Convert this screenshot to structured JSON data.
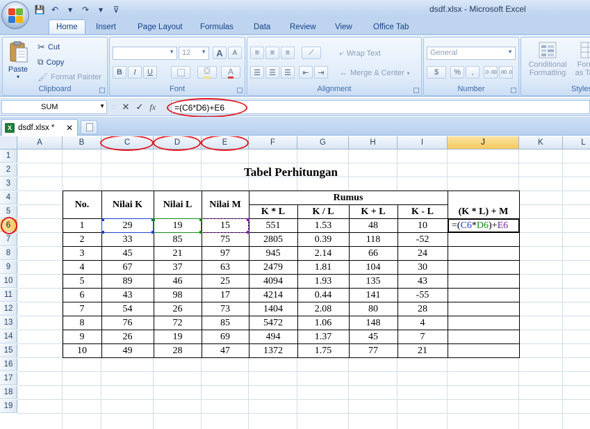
{
  "window": {
    "title": "dsdf.xlsx - Microsoft Excel",
    "quick_access": [
      {
        "icon": "save-icon",
        "glyph": "💾"
      },
      {
        "icon": "undo-icon",
        "glyph": "↶"
      },
      {
        "icon": "undo-dropdown-icon",
        "glyph": "▾"
      },
      {
        "icon": "redo-icon",
        "glyph": "↷"
      },
      {
        "icon": "redo-dropdown-icon",
        "glyph": "▾"
      },
      {
        "icon": "customize-qat-icon",
        "glyph": "⊽"
      }
    ]
  },
  "ribbon": {
    "tabs": [
      "Home",
      "Insert",
      "Page Layout",
      "Formulas",
      "Data",
      "Review",
      "View",
      "Office Tab"
    ],
    "active_tab": "Home",
    "clipboard": {
      "label": "Clipboard",
      "paste": "Paste",
      "cut": "Cut",
      "copy": "Copy",
      "format_painter": "Format Painter"
    },
    "font": {
      "label": "Font",
      "font_name": "",
      "font_size": "12",
      "bold": "B",
      "italic": "I",
      "underline": "U",
      "grow": "A",
      "shrink": "A"
    },
    "alignment": {
      "label": "Alignment",
      "wrap_text": "Wrap Text",
      "merge_center": "Merge & Center"
    },
    "number": {
      "label": "Number",
      "format": "General",
      "currency": "$",
      "percent": "%",
      "comma": ",",
      "inc_decimal": ".0 .00",
      "dec_decimal": ".00 .0"
    },
    "styles": {
      "label": "Styles",
      "conditional_formatting": "Conditional Formatting",
      "format_as_table": "Format as Table"
    }
  },
  "formula_bar": {
    "name_box": "SUM",
    "cancel_glyph": "✕",
    "enter_glyph": "✓",
    "fx": "fx",
    "formula": "=(C6*D6)+E6"
  },
  "document_tab": {
    "name": "dsdf.xlsx *",
    "close": "✕"
  },
  "sheet": {
    "columns": [
      "A",
      "B",
      "C",
      "D",
      "E",
      "F",
      "G",
      "H",
      "I",
      "J",
      "K",
      "L"
    ],
    "selected_column": "J",
    "rows": [
      "1",
      "2",
      "3",
      "4",
      "5",
      "6",
      "7",
      "8",
      "9",
      "10",
      "11",
      "12",
      "13",
      "14",
      "15",
      "16",
      "17",
      "18",
      "19"
    ],
    "selected_row": "6",
    "title": "Tabel Perhitungan",
    "headers": {
      "no": "No.",
      "nilai_k": "Nilai K",
      "nilai_l": "Nilai L",
      "nilai_m": "Nilai M",
      "rumus": "Rumus",
      "kxl": "K * L",
      "kdl": "K / L",
      "kpl": "K + L",
      "kml": "K - L",
      "formula_col": "(K * L) + M"
    },
    "data": [
      [
        "1",
        "29",
        "19",
        "15",
        "551",
        "1.53",
        "48",
        "10"
      ],
      [
        "2",
        "33",
        "85",
        "75",
        "2805",
        "0.39",
        "118",
        "-52"
      ],
      [
        "3",
        "45",
        "21",
        "97",
        "945",
        "2.14",
        "66",
        "24"
      ],
      [
        "4",
        "67",
        "37",
        "63",
        "2479",
        "1.81",
        "104",
        "30"
      ],
      [
        "5",
        "89",
        "46",
        "25",
        "4094",
        "1.93",
        "135",
        "43"
      ],
      [
        "6",
        "43",
        "98",
        "17",
        "4214",
        "0.44",
        "141",
        "-55"
      ],
      [
        "7",
        "54",
        "26",
        "73",
        "1404",
        "2.08",
        "80",
        "28"
      ],
      [
        "8",
        "76",
        "72",
        "85",
        "5472",
        "1.06",
        "148",
        "4"
      ],
      [
        "9",
        "26",
        "19",
        "69",
        "494",
        "1.37",
        "45",
        "7"
      ],
      [
        "10",
        "49",
        "28",
        "47",
        "1372",
        "1.75",
        "77",
        "21"
      ]
    ],
    "editing_cell": {
      "prefix": "=(",
      "ref1": "C6",
      "op1": "*",
      "ref2": "D6",
      "suffix": ")+",
      "ref3": "E6"
    },
    "colors": {
      "ref1": "#1f3fd0",
      "ref2": "#108a10",
      "ref3": "#7a1fa0",
      "annotation": "#e0161d"
    }
  }
}
